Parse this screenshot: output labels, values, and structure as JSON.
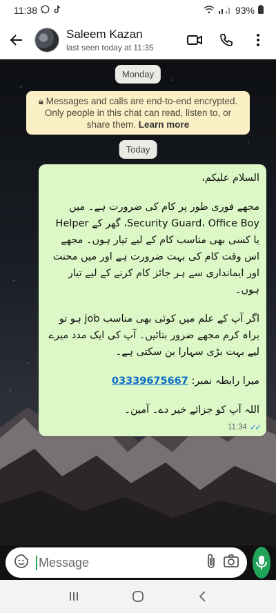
{
  "status_bar": {
    "time": "11:38",
    "battery": "93%",
    "icons": [
      "whatsapp-icon",
      "tiktok-icon",
      "wifi-icon",
      "signal-icon",
      "battery-icon"
    ]
  },
  "header": {
    "contact_name": "Saleem Kazan",
    "last_seen": "last seen today at 11:35",
    "actions": [
      "video-call-icon",
      "phone-icon",
      "more-vert-icon"
    ]
  },
  "chat": {
    "date_pill_1": "Monday",
    "encryption_text": "Messages and calls are end-to-end encrypted. Only people in this chat can read, listen to, or share them.",
    "encryption_link": "Learn more",
    "date_pill_2": "Today",
    "message": {
      "line_greeting": "السلام علیکم،",
      "para_1": "مجھے فوری طور پر کام کی ضرورت ہے۔ میں Security Guard، Office Boy، گھر کے Helper یا کسی بھی مناسب کام کے لیے تیار ہوں۔ مجھے اس وقت کام کی بہت ضرورت ہے اور میں محنت اور ایمانداری سے ہر جائز کام کرنے کے لیے تیار ہوں۔",
      "para_2": "اگر آپ کے علم میں کوئی بھی مناسب job ہو تو براہ کرم مجھے ضرور بتائیں۔ آپ کی ایک مدد میرے لیے بہت بڑی سہارا بن سکتی ہے۔",
      "contact_label": "میرا رابطہ نمبر:",
      "phone": "03339675667",
      "closing": "اللہ آپ کو جزائے خیر دے۔ آمین۔",
      "time": "11:34"
    }
  },
  "composer": {
    "placeholder": "Message"
  },
  "colors": {
    "bubble": "#dcf8c6",
    "encryption_bg": "#fbefc6",
    "accent_green": "#21a35a",
    "link": "#0b6bcb"
  }
}
